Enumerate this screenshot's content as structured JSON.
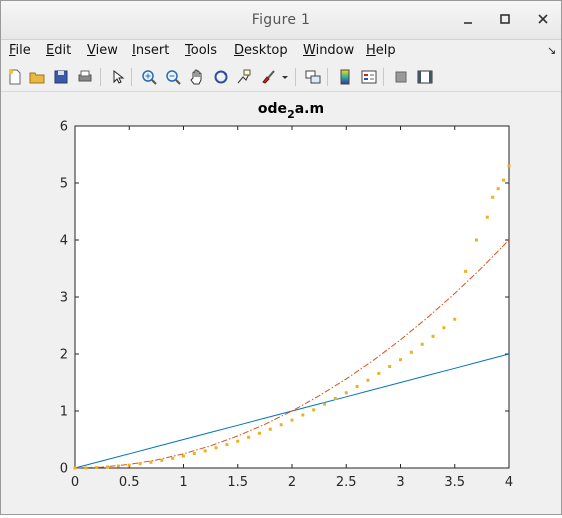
{
  "window": {
    "title": "Figure 1"
  },
  "menus": [
    {
      "label": "File",
      "u": "F",
      "rest": "ile"
    },
    {
      "label": "Edit",
      "u": "E",
      "rest": "dit"
    },
    {
      "label": "View",
      "u": "V",
      "rest": "iew"
    },
    {
      "label": "Insert",
      "u": "I",
      "rest": "nsert"
    },
    {
      "label": "Tools",
      "u": "T",
      "rest": "ools"
    },
    {
      "label": "Desktop",
      "u": "D",
      "rest": "esktop"
    },
    {
      "label": "Window",
      "u": "W",
      "rest": "indow"
    },
    {
      "label": "Help",
      "u": "H",
      "rest": "elp"
    }
  ],
  "toolbar": [
    "new-figure-icon",
    "open-file-icon",
    "save-icon",
    "print-icon",
    "pointer-icon",
    "zoom-in-icon",
    "zoom-out-icon",
    "pan-hand-icon",
    "rotate-3d-icon",
    "data-cursor-icon",
    "brush-icon",
    "brush-dropdown-icon",
    "link-plot-icon",
    "colorbar-icon",
    "legend-icon",
    "hide-plot-tools-icon",
    "show-plot-tools-icon"
  ],
  "chart_data": {
    "type": "line",
    "title": "ode2a.m",
    "title_main": "ode",
    "title_sub": "2",
    "title_rest": "a.m",
    "xlabel": "",
    "ylabel": "",
    "xlim": [
      0,
      4
    ],
    "ylim": [
      0,
      6
    ],
    "xticks": [
      "0",
      "0.5",
      "1",
      "1.5",
      "2",
      "2.5",
      "3",
      "3.5",
      "4"
    ],
    "yticks": [
      "0",
      "1",
      "2",
      "3",
      "4",
      "5",
      "6"
    ],
    "grid": false,
    "series": [
      {
        "style": "solid",
        "color": "#0072bd",
        "x": [
          0,
          0.25,
          0.5,
          0.75,
          1,
          1.25,
          1.5,
          1.75,
          2,
          2.25,
          2.5,
          2.75,
          3,
          3.25,
          3.5,
          3.75,
          4
        ],
        "y": [
          0,
          0.125,
          0.25,
          0.375,
          0.5,
          0.625,
          0.75,
          0.875,
          1.0,
          1.125,
          1.25,
          1.375,
          1.5,
          1.625,
          1.75,
          1.875,
          2.0
        ]
      },
      {
        "style": "dashdot",
        "color": "#d95319",
        "x": [
          0,
          0.25,
          0.5,
          0.75,
          1,
          1.25,
          1.5,
          1.75,
          2,
          2.25,
          2.5,
          2.75,
          3,
          3.25,
          3.5,
          3.75,
          4
        ],
        "y": [
          0,
          0.016,
          0.0625,
          0.14,
          0.25,
          0.39,
          0.5625,
          0.766,
          1.0,
          1.266,
          1.5625,
          1.89,
          2.25,
          2.64,
          3.0625,
          3.516,
          4.0
        ]
      },
      {
        "style": "dotted",
        "color": "#edb120",
        "x": [
          0,
          0.1,
          0.2,
          0.3,
          0.4,
          0.5,
          0.6,
          0.7,
          0.8,
          0.9,
          1.0,
          1.1,
          1.2,
          1.3,
          1.4,
          1.5,
          1.6,
          1.7,
          1.8,
          1.9,
          2.0,
          2.1,
          2.2,
          2.3,
          2.4,
          2.5,
          2.6,
          2.7,
          2.8,
          2.9,
          3.0,
          3.1,
          3.2,
          3.3,
          3.4,
          3.5,
          3.6,
          3.7,
          3.8,
          3.85,
          3.9,
          3.95,
          4.0
        ],
        "y": [
          0,
          0.002,
          0.008,
          0.019,
          0.034,
          0.05,
          0.075,
          0.1,
          0.135,
          0.17,
          0.21,
          0.255,
          0.3,
          0.355,
          0.41,
          0.47,
          0.54,
          0.61,
          0.68,
          0.76,
          0.84,
          0.93,
          1.02,
          1.12,
          1.22,
          1.32,
          1.43,
          1.54,
          1.66,
          1.78,
          1.9,
          2.03,
          2.17,
          2.31,
          2.46,
          2.61,
          3.45,
          4.0,
          4.4,
          4.75,
          4.9,
          5.05,
          5.3
        ]
      }
    ]
  }
}
